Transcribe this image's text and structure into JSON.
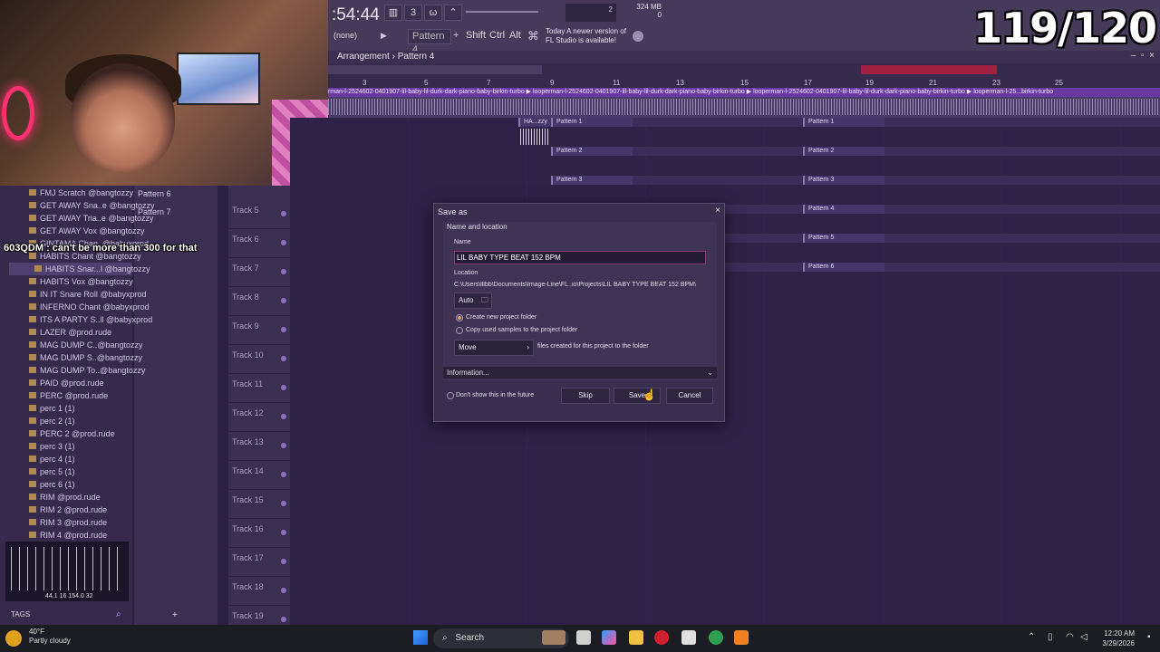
{
  "overlay": {
    "counter": "119/120",
    "chat_message": "603QDM : can't be more than 300 for that"
  },
  "toolbar": {
    "clock": ":54:44",
    "cpu": "2",
    "memory": "324 MB",
    "poly": "0",
    "snap": "(none)",
    "pattern": "Pattern 4",
    "keys": [
      "Shift",
      "Ctrl",
      "Alt"
    ],
    "news_line1": "Today  A newer version of",
    "news_line2": "FL Studio is available!"
  },
  "playlist": {
    "breadcrumb_a": "Arrangement",
    "breadcrumb_sep": "›",
    "breadcrumb_b": "Pattern 4",
    "ruler_ticks": [
      "3",
      "5",
      "7",
      "9",
      "11",
      "13",
      "15",
      "17",
      "19",
      "21",
      "23",
      "25"
    ],
    "audio_clip_label": "rman-l-2524602-0401907-lil-baby-lil-durk-dark-piano-baby-birkin-turbo  ▶ looperman-l-2524602-0401907-lil-baby-lil-durk-dark-piano-baby-birkin-turbo  ▶ looperman-l-2524602-0401907-lil-baby-lil-durk-dark-piano-baby-birkin-turbo  ▶ looperman-l-25...birkin-turbo",
    "clip_hazzy": "HA...zzy",
    "patterns": [
      "Pattern 1",
      "Pattern 1",
      "Pattern 2",
      "Pattern 2",
      "Pattern 3",
      "Pattern 3",
      "Pattern 4",
      "Pattern 5",
      "Pattern 6"
    ],
    "tracks": [
      "Track 5",
      "Track 6",
      "Track 7",
      "Track 8",
      "Track 9",
      "Track 10",
      "Track 11",
      "Track 12",
      "Track 13",
      "Track 14",
      "Track 15",
      "Track 16",
      "Track 17",
      "Track 18",
      "Track 19"
    ]
  },
  "pattern_list": [
    "Pattern 6",
    "Pattern 7"
  ],
  "browser": {
    "items": [
      "FMJ Scratch @bangtozzy",
      "GET AWAY Sna..e @bangtozzy",
      "GET AWAY Tria..e @bangtozzy",
      "GET AWAY Vox @bangtozzy",
      "GINTAMA Chan..@babyxprod",
      "HABITS Chant @bangtozzy",
      "HABITS Snar...l @bangtozzy",
      "HABITS Vox @bangtozzy",
      "IN IT Snare Roll @babyxprod",
      "INFERNO Chant @babyxprod",
      "ITS A PARTY S..ll @babyxprod",
      "LAZER @prod.rude",
      "MAG DUMP C..@bangtozzy",
      "MAG DUMP S..@bangtozzy",
      "MAG DUMP To..@bangtozzy",
      "PAID @prod.rude",
      "PERC @prod.rude",
      "perc 1 (1)",
      "perc 2 (1)",
      "PERC 2 @prod.rude",
      "perc 3 (1)",
      "perc 4 (1)",
      "perc 5 (1)",
      "perc 6 (1)",
      "RIM @prod.rude",
      "RIM 2 @prod.rude",
      "RIM 3 @prod.rude",
      "RIM 4 @prod.rude"
    ],
    "sample_info": "44.1  16  154.0  32",
    "tags": "TAGS"
  },
  "dialog": {
    "title": "Save as",
    "close": "×",
    "section": "Name and location",
    "name_label": "Name",
    "name_value": "LIL BABY TYPE BEAT 152 BPM",
    "location_label": "Location",
    "location_value": "C:\\Users\\lllbb\\Documents\\Image-Line\\FL..io\\Projects\\LIL BABY TYPE BEAT 152 BPM\\",
    "auto_label": "Auto",
    "opt_new_folder": "Create new project folder",
    "opt_copy_samples": "Copy used samples to the project folder",
    "move_label": "Move",
    "move_suffix": "files created for this project to the folder",
    "information": "Information...",
    "dont_show": "Don't show this in the future",
    "skip": "Skip",
    "save": "Save",
    "cancel": "Cancel"
  },
  "taskbar": {
    "temp": "40°F",
    "weather": "Partly cloudy",
    "search": "Search",
    "time": "12:20 AM",
    "date": "3/29/2026"
  },
  "colors": {
    "accent": "#8a3a70",
    "workspace": "#2f2048",
    "toolbar": "#453a5a"
  }
}
